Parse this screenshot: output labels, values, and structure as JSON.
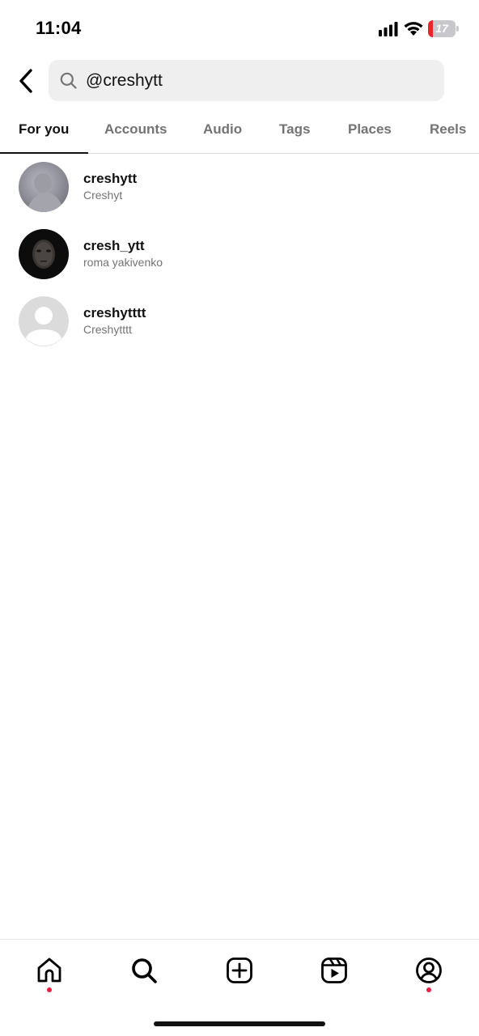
{
  "status_bar": {
    "time": "11:04",
    "battery_level": "17",
    "battery_color": "#e8262a"
  },
  "search": {
    "value": "@creshytt",
    "icon": "search-icon"
  },
  "tabs": [
    {
      "label": "For you",
      "active": true
    },
    {
      "label": "Accounts",
      "active": false
    },
    {
      "label": "Audio",
      "active": false
    },
    {
      "label": "Tags",
      "active": false
    },
    {
      "label": "Places",
      "active": false
    },
    {
      "label": "Reels",
      "active": false
    }
  ],
  "results": [
    {
      "username": "creshytt",
      "full_name": "Creshyt",
      "avatar": "photo-gray"
    },
    {
      "username": "cresh_ytt",
      "full_name": "roma yakivenko",
      "avatar": "photo-dark"
    },
    {
      "username": "creshytttt",
      "full_name": "Creshytttt",
      "avatar": "default-avatar-icon"
    }
  ],
  "bottom_nav": [
    {
      "icon": "home-icon",
      "notification_dot": true
    },
    {
      "icon": "search-icon",
      "notification_dot": false
    },
    {
      "icon": "create-post-icon",
      "notification_dot": false
    },
    {
      "icon": "reels-icon",
      "notification_dot": false
    },
    {
      "icon": "profile-icon",
      "notification_dot": true
    }
  ],
  "colors": {
    "notification_dot": "#ed1c40",
    "secondary_text": "#737373",
    "search_bg": "#efeff0"
  }
}
